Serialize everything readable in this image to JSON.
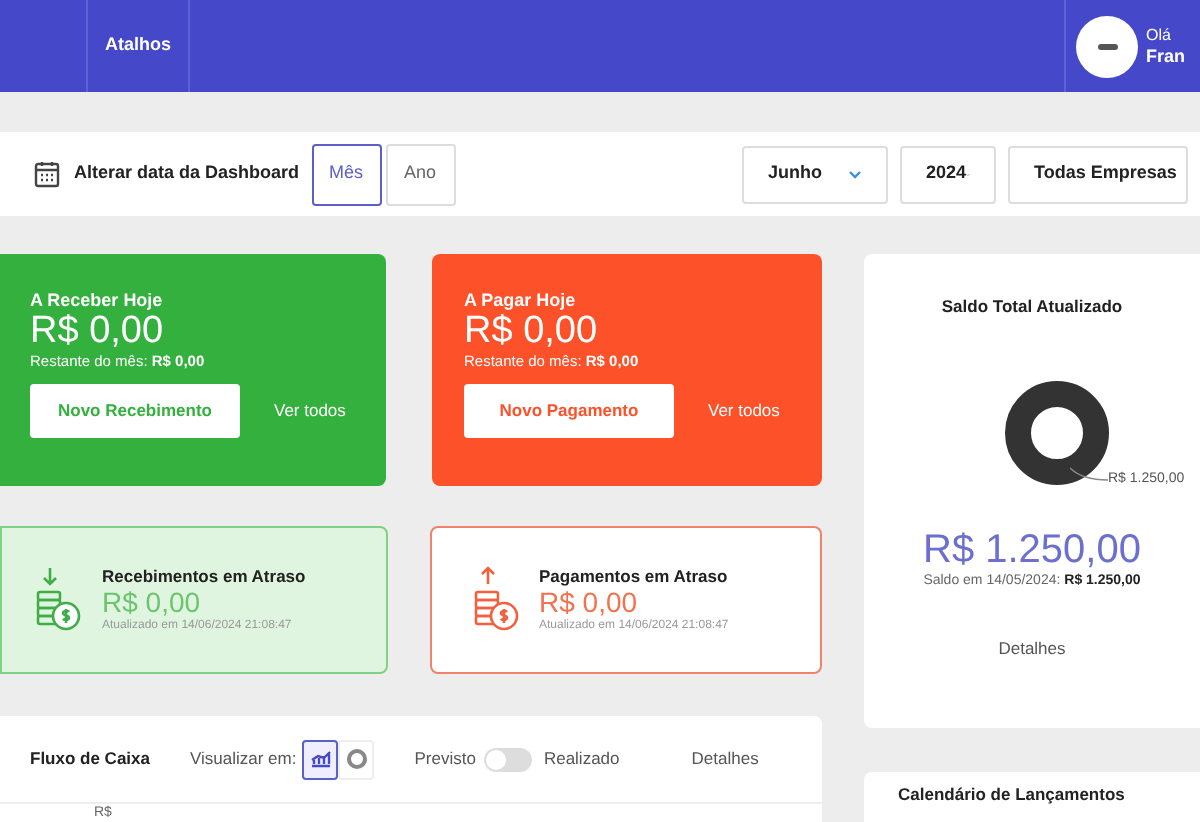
{
  "header": {
    "nav": [
      {
        "label": "Atalhos"
      }
    ],
    "greeting": "Olá",
    "user_name": "Fran"
  },
  "toolbar": {
    "label": "Alterar data da Dashboard",
    "modes": [
      {
        "label": "Mês",
        "selected": true
      },
      {
        "label": "Ano",
        "selected": false
      }
    ],
    "selects": [
      {
        "value": "Junho"
      },
      {
        "value": "2024"
      },
      {
        "value": "Todas Empresas"
      }
    ]
  },
  "today_cards": [
    {
      "kind": "receive",
      "title": "A Receber Hoje",
      "amount": "R$ 0,00",
      "remaining_label": "Restante do mês:",
      "remaining": "R$ 0,00",
      "button": "Novo Recebimento",
      "link": "Ver todos"
    },
    {
      "kind": "pay",
      "title": "A Pagar Hoje",
      "amount": "R$ 0,00",
      "remaining_label": "Restante do mês:",
      "remaining": "R$ 0,00",
      "button": "Novo Pagamento",
      "link": "Ver todos"
    }
  ],
  "overdue_cards": [
    {
      "kind": "receive",
      "title": "Recebimentos em Atraso",
      "amount": "R$ 0,00",
      "updated": "Atualizado em 14/06/2024 21:08:47"
    },
    {
      "kind": "pay",
      "title": "Pagamentos em Atraso",
      "amount": "R$ 0,00",
      "updated": "Atualizado em 14/06/2024 21:08:47"
    }
  ],
  "cash_flow": {
    "title": "Fluxo de Caixa",
    "view_label": "Visualizar em:",
    "views": [
      {
        "kind": "line",
        "selected": true
      },
      {
        "kind": "donut",
        "selected": false
      }
    ],
    "left_label": "Previsto",
    "toggle_on": false,
    "right_label": "Realizado",
    "details": "Detalhes",
    "axis_label": "R$"
  },
  "balance": {
    "title": "Saldo Total Atualizado",
    "ring_label": "R$ 1.250,00",
    "amount": "R$ 1.250,00",
    "date_label": "Saldo em 14/05/2024:",
    "date_amount": "R$ 1.250,00",
    "details": "Detalhes"
  },
  "calendar": {
    "title": "Calendário de Lançamentos"
  }
}
